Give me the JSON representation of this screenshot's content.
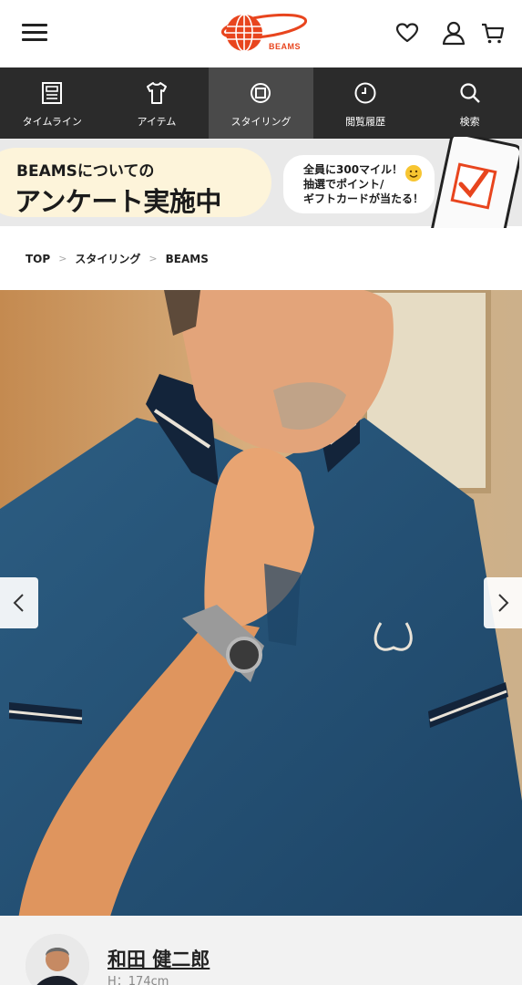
{
  "header": {
    "logo_text": "BEAMS",
    "brand_color": "#e8451e",
    "icons": [
      "menu-icon",
      "heart-icon",
      "user-icon",
      "cart-icon"
    ]
  },
  "nav": {
    "items": [
      {
        "label": "タイムライン",
        "icon": "timeline-icon"
      },
      {
        "label": "アイテム",
        "icon": "tshirt-icon"
      },
      {
        "label": "スタイリング",
        "icon": "styling-icon",
        "active": true
      },
      {
        "label": "閲覧履歴",
        "icon": "clock-icon"
      },
      {
        "label": "検索",
        "icon": "search-icon"
      }
    ]
  },
  "banner": {
    "line1": "BEAMSについての",
    "line2": "アンケート実施中",
    "bubble": "全員に300マイル！\n抽選でポイント/\nギフトカードが当たる！"
  },
  "breadcrumb": {
    "items": [
      "TOP",
      "スタイリング",
      "BEAMS"
    ],
    "separator": ">"
  },
  "carousel": {
    "prev_icon": "chevron-left-icon",
    "next_icon": "chevron-right-icon"
  },
  "staff": {
    "name": "和田 健二郎",
    "height": "H：174cm"
  }
}
